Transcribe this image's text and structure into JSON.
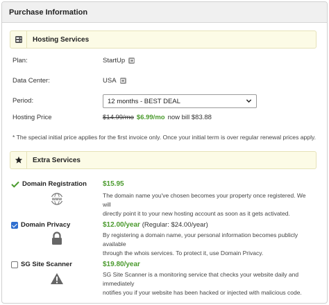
{
  "panel": {
    "title": "Purchase Information"
  },
  "hosting": {
    "section_title": "Hosting Services",
    "section_icon": "server-icon",
    "plan_label": "Plan:",
    "plan_value": "StartUp",
    "datacenter_label": "Data Center:",
    "datacenter_value": "USA",
    "period_label": "Period:",
    "period_selected": "12 months - BEST DEAL",
    "price_label": "Hosting Price",
    "price_old": "$14.99/mo",
    "price_new": "$6.99/mo",
    "price_bill": "now bill $83.88",
    "note": "* The special initial price applies for the first invoice only. Once your initial term is over regular renewal prices apply."
  },
  "extras": {
    "section_title": "Extra Services",
    "section_icon": "star-icon",
    "items": [
      {
        "name": "Domain Registration",
        "state": "included-check",
        "price": "$15.95",
        "regular": "",
        "icon": "www-globe-icon",
        "icon_text": "www",
        "desc_line1": "The domain name you've chosen becomes your property once registered. We will",
        "desc_line2": "directly point it to your new hosting account as soon as it gets activated."
      },
      {
        "name": "Domain Privacy",
        "state": "checked",
        "price": "$12.00/year",
        "regular": "(Regular: $24.00/year)",
        "icon": "lock-icon",
        "desc_line1": "By registering a domain name, your personal information becomes publicly available",
        "desc_line2": "through the whois services. To protect it, use Domain Privacy."
      },
      {
        "name": "SG Site Scanner",
        "state": "unchecked",
        "price": "$19.80/year",
        "regular": "",
        "icon": "warning-icon",
        "desc_line1": "SG Site Scanner is a monitoring service that checks your website daily and immediately",
        "desc_line2": "notifies you if your website has been hacked or injected with malicious code."
      }
    ]
  },
  "colors": {
    "accent_green": "#4a9a2d",
    "section_bg": "#fcfbe6",
    "checkbox_blue": "#2f6fd0"
  }
}
